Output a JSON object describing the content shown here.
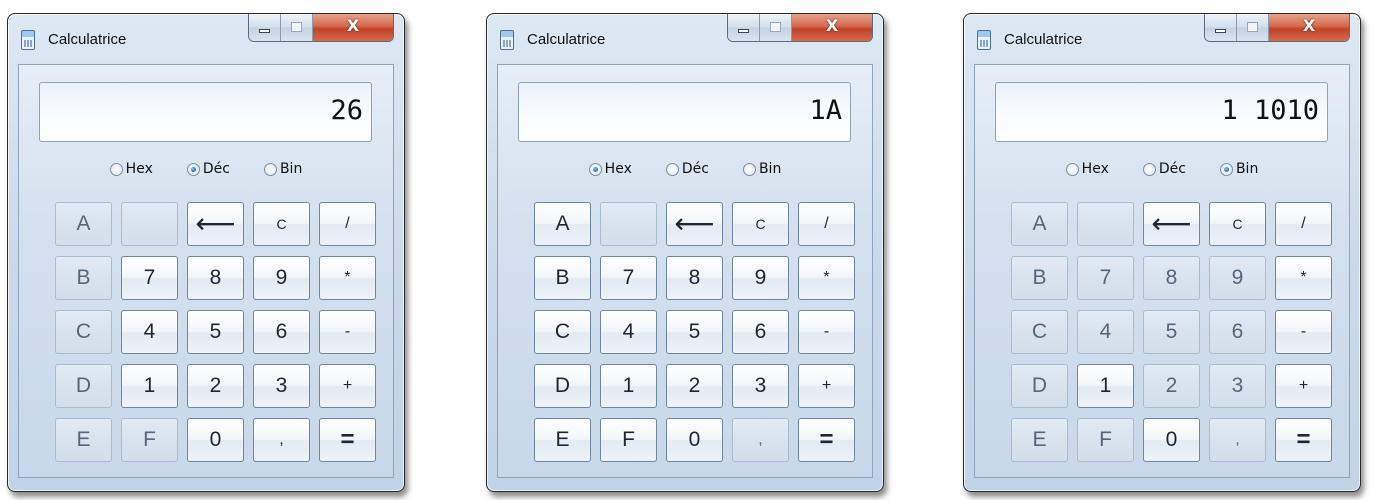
{
  "windows": [
    {
      "title": "Calculatrice",
      "display": "26",
      "radios": [
        {
          "label": "Hex",
          "checked": false
        },
        {
          "label": "Déc",
          "checked": true
        },
        {
          "label": "Bin",
          "checked": false
        }
      ],
      "keys": [
        {
          "label": "A",
          "enabled": false
        },
        {
          "label": "",
          "enabled": false
        },
        {
          "label": "⟵",
          "enabled": true
        },
        {
          "label": "C",
          "enabled": true
        },
        {
          "label": "/",
          "enabled": true
        },
        {
          "label": "B",
          "enabled": false
        },
        {
          "label": "7",
          "enabled": true
        },
        {
          "label": "8",
          "enabled": true
        },
        {
          "label": "9",
          "enabled": true
        },
        {
          "label": "*",
          "enabled": true
        },
        {
          "label": "C",
          "enabled": false
        },
        {
          "label": "4",
          "enabled": true
        },
        {
          "label": "5",
          "enabled": true
        },
        {
          "label": "6",
          "enabled": true
        },
        {
          "label": "-",
          "enabled": true
        },
        {
          "label": "D",
          "enabled": false
        },
        {
          "label": "1",
          "enabled": true
        },
        {
          "label": "2",
          "enabled": true
        },
        {
          "label": "3",
          "enabled": true
        },
        {
          "label": "+",
          "enabled": true
        },
        {
          "label": "E",
          "enabled": false
        },
        {
          "label": "F",
          "enabled": false
        },
        {
          "label": "0",
          "enabled": true
        },
        {
          "label": ",",
          "enabled": true
        },
        {
          "label": "=",
          "enabled": true
        }
      ]
    },
    {
      "title": "Calculatrice",
      "display": "1A",
      "radios": [
        {
          "label": "Hex",
          "checked": true
        },
        {
          "label": "Déc",
          "checked": false
        },
        {
          "label": "Bin",
          "checked": false
        }
      ],
      "keys": [
        {
          "label": "A",
          "enabled": true
        },
        {
          "label": "",
          "enabled": false
        },
        {
          "label": "⟵",
          "enabled": true
        },
        {
          "label": "C",
          "enabled": true
        },
        {
          "label": "/",
          "enabled": true
        },
        {
          "label": "B",
          "enabled": true
        },
        {
          "label": "7",
          "enabled": true
        },
        {
          "label": "8",
          "enabled": true
        },
        {
          "label": "9",
          "enabled": true
        },
        {
          "label": "*",
          "enabled": true
        },
        {
          "label": "C",
          "enabled": true
        },
        {
          "label": "4",
          "enabled": true
        },
        {
          "label": "5",
          "enabled": true
        },
        {
          "label": "6",
          "enabled": true
        },
        {
          "label": "-",
          "enabled": true
        },
        {
          "label": "D",
          "enabled": true
        },
        {
          "label": "1",
          "enabled": true
        },
        {
          "label": "2",
          "enabled": true
        },
        {
          "label": "3",
          "enabled": true
        },
        {
          "label": "+",
          "enabled": true
        },
        {
          "label": "E",
          "enabled": true
        },
        {
          "label": "F",
          "enabled": true
        },
        {
          "label": "0",
          "enabled": true
        },
        {
          "label": ",",
          "enabled": false
        },
        {
          "label": "=",
          "enabled": true
        }
      ]
    },
    {
      "title": "Calculatrice",
      "display": "1 1010",
      "radios": [
        {
          "label": "Hex",
          "checked": false
        },
        {
          "label": "Déc",
          "checked": false
        },
        {
          "label": "Bin",
          "checked": true
        }
      ],
      "keys": [
        {
          "label": "A",
          "enabled": false
        },
        {
          "label": "",
          "enabled": false
        },
        {
          "label": "⟵",
          "enabled": true
        },
        {
          "label": "C",
          "enabled": true
        },
        {
          "label": "/",
          "enabled": true
        },
        {
          "label": "B",
          "enabled": false
        },
        {
          "label": "7",
          "enabled": false
        },
        {
          "label": "8",
          "enabled": false
        },
        {
          "label": "9",
          "enabled": false
        },
        {
          "label": "*",
          "enabled": true
        },
        {
          "label": "C",
          "enabled": false
        },
        {
          "label": "4",
          "enabled": false
        },
        {
          "label": "5",
          "enabled": false
        },
        {
          "label": "6",
          "enabled": false
        },
        {
          "label": "-",
          "enabled": true
        },
        {
          "label": "D",
          "enabled": false
        },
        {
          "label": "1",
          "enabled": true
        },
        {
          "label": "2",
          "enabled": false
        },
        {
          "label": "3",
          "enabled": false
        },
        {
          "label": "+",
          "enabled": true
        },
        {
          "label": "E",
          "enabled": false
        },
        {
          "label": "F",
          "enabled": false
        },
        {
          "label": "0",
          "enabled": true
        },
        {
          "label": ",",
          "enabled": false
        },
        {
          "label": "=",
          "enabled": true
        }
      ]
    }
  ],
  "window_controls": {
    "close_label": "X"
  }
}
